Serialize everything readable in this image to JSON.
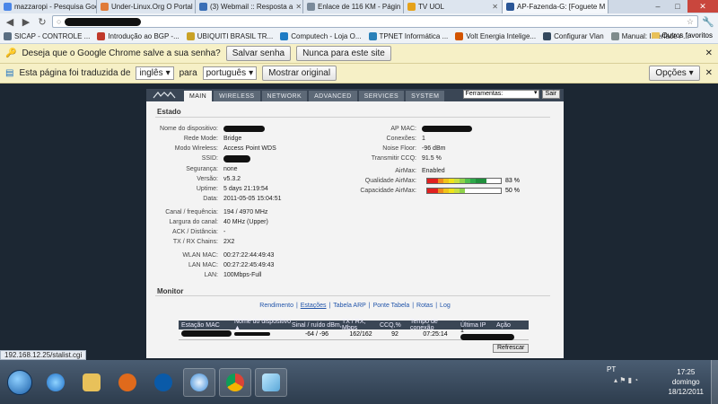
{
  "browser": {
    "tabs": [
      {
        "label": "mazzaropi - Pesquisa Goog",
        "color": "#4a86e8"
      },
      {
        "label": "Under-Linux.Org O Portal d",
        "color": "#e07b39"
      },
      {
        "label": "(3) Webmail :: Resposta a",
        "color": "#3b6fb6"
      },
      {
        "label": "Enlace de 116 KM - Págin",
        "color": "#7a8a9a"
      },
      {
        "label": "TV UOL",
        "color": "#e5a21b"
      },
      {
        "label": "AP-Fazenda-G: [Foguete M",
        "color": "#2b5797"
      }
    ],
    "window_controls": {
      "minimize": "–",
      "maximize": "□",
      "close": "✕"
    },
    "bookmarks": [
      {
        "label": "SICAP - CONTROLE ...",
        "color": "#5b6f83"
      },
      {
        "label": "Introdução ao BGP -...",
        "color": "#c0392b"
      },
      {
        "label": "UBIQUITI BRASIL TR...",
        "color": "#c9a227"
      },
      {
        "label": "Computech - Loja O...",
        "color": "#1e7bc4"
      },
      {
        "label": "TPNET Informática ...",
        "color": "#2980b9"
      },
      {
        "label": "Volt Energia Intelige...",
        "color": "#d35400"
      },
      {
        "label": "Configurar Vlan",
        "color": "#34495e"
      },
      {
        "label": "Manual: Interface / ...",
        "color": "#7f8c8d"
      }
    ],
    "other_bookmarks": "Outros favoritos"
  },
  "password_bar": {
    "question": "Deseja que o Google Chrome salve a sua senha?",
    "save": "Salvar senha",
    "never": "Nunca para este site",
    "close": "✕"
  },
  "translate_bar": {
    "prefix": "Esta página foi traduzida de",
    "from": "inglês",
    "middle": "para",
    "to": "português",
    "show_original": "Mostrar original",
    "options": "Opções",
    "close": "✕"
  },
  "airos": {
    "tabs": [
      "MAIN",
      "WIRELESS",
      "NETWORK",
      "ADVANCED",
      "SERVICES",
      "SYSTEM"
    ],
    "tools_select": "Ferramentas:",
    "tools_button": "Sair",
    "status_title": "Estado",
    "left": [
      {
        "label": "Nome do dispositivo:",
        "value": "",
        "redacted": true
      },
      {
        "label": "Rede Mode:",
        "value": "Bridge"
      },
      {
        "label": "Modo Wireless:",
        "value": "Access Point WDS"
      },
      {
        "label": "SSID:",
        "value": "",
        "redacted": true
      },
      {
        "label": "Segurança:",
        "value": "none"
      },
      {
        "label": "Versão:",
        "value": "v5.3.2"
      },
      {
        "label": "Uptime:",
        "value": "5 days 21:19:54"
      },
      {
        "label": "Data:",
        "value": "2011-05-05 15:04:51"
      },
      {
        "label": "Canal / frequência:",
        "value": "194 / 4970 MHz"
      },
      {
        "label": "Largura do canal:",
        "value": "40 MHz (Upper)"
      },
      {
        "label": "ACK / Distância:",
        "value": "-"
      },
      {
        "label": "TX / RX Chains:",
        "value": "2X2"
      },
      {
        "label": "WLAN MAC:",
        "value": "00:27:22:44:49:43"
      },
      {
        "label": "LAN MAC:",
        "value": "00:27:22:45:49:43"
      },
      {
        "label": "LAN:",
        "value": "100Mbps-Full"
      }
    ],
    "right": [
      {
        "label": "AP MAC:",
        "value": "",
        "redacted": true
      },
      {
        "label": "Conexões:",
        "value": "1"
      },
      {
        "label": "Noise Floor:",
        "value": "-96 dBm"
      },
      {
        "label": "Transmitir CCQ:",
        "value": "91.5 %"
      },
      {
        "label": "AirMax:",
        "value": "Enabled"
      }
    ],
    "airmax_quality": {
      "label": "Qualidade AirMax:",
      "value": "83 %",
      "fraction": 0.83
    },
    "airmax_capacity": {
      "label": "Capacidade AirMax:",
      "value": "50 %",
      "fraction": 0.5
    },
    "monitor_title": "Monitor",
    "monitor_links": [
      "Rendimento",
      "Estações",
      "Tabela ARP",
      "Ponte Tabela",
      "Rotas",
      "Log"
    ],
    "table_headers": [
      "Estação MAC",
      "Nome do dispositivo ▲",
      "Sinal / ruído dBm,",
      "TX / RX, Mbps",
      "CCQ,%",
      "Tempo de conexão",
      "Última IP",
      "Ação"
    ],
    "table_row": {
      "signal": "-64 / -96",
      "txrx": "162/162",
      "ccq": "92",
      "time": "07:25:14",
      "ip_prefix": "1"
    },
    "refresh": "Refrescar"
  },
  "status_url": "192.168.12.25/stalist.cgi",
  "taskbar": {
    "lang": "PT",
    "time": "17:25",
    "day": "domingo",
    "date": "18/12/2011"
  }
}
